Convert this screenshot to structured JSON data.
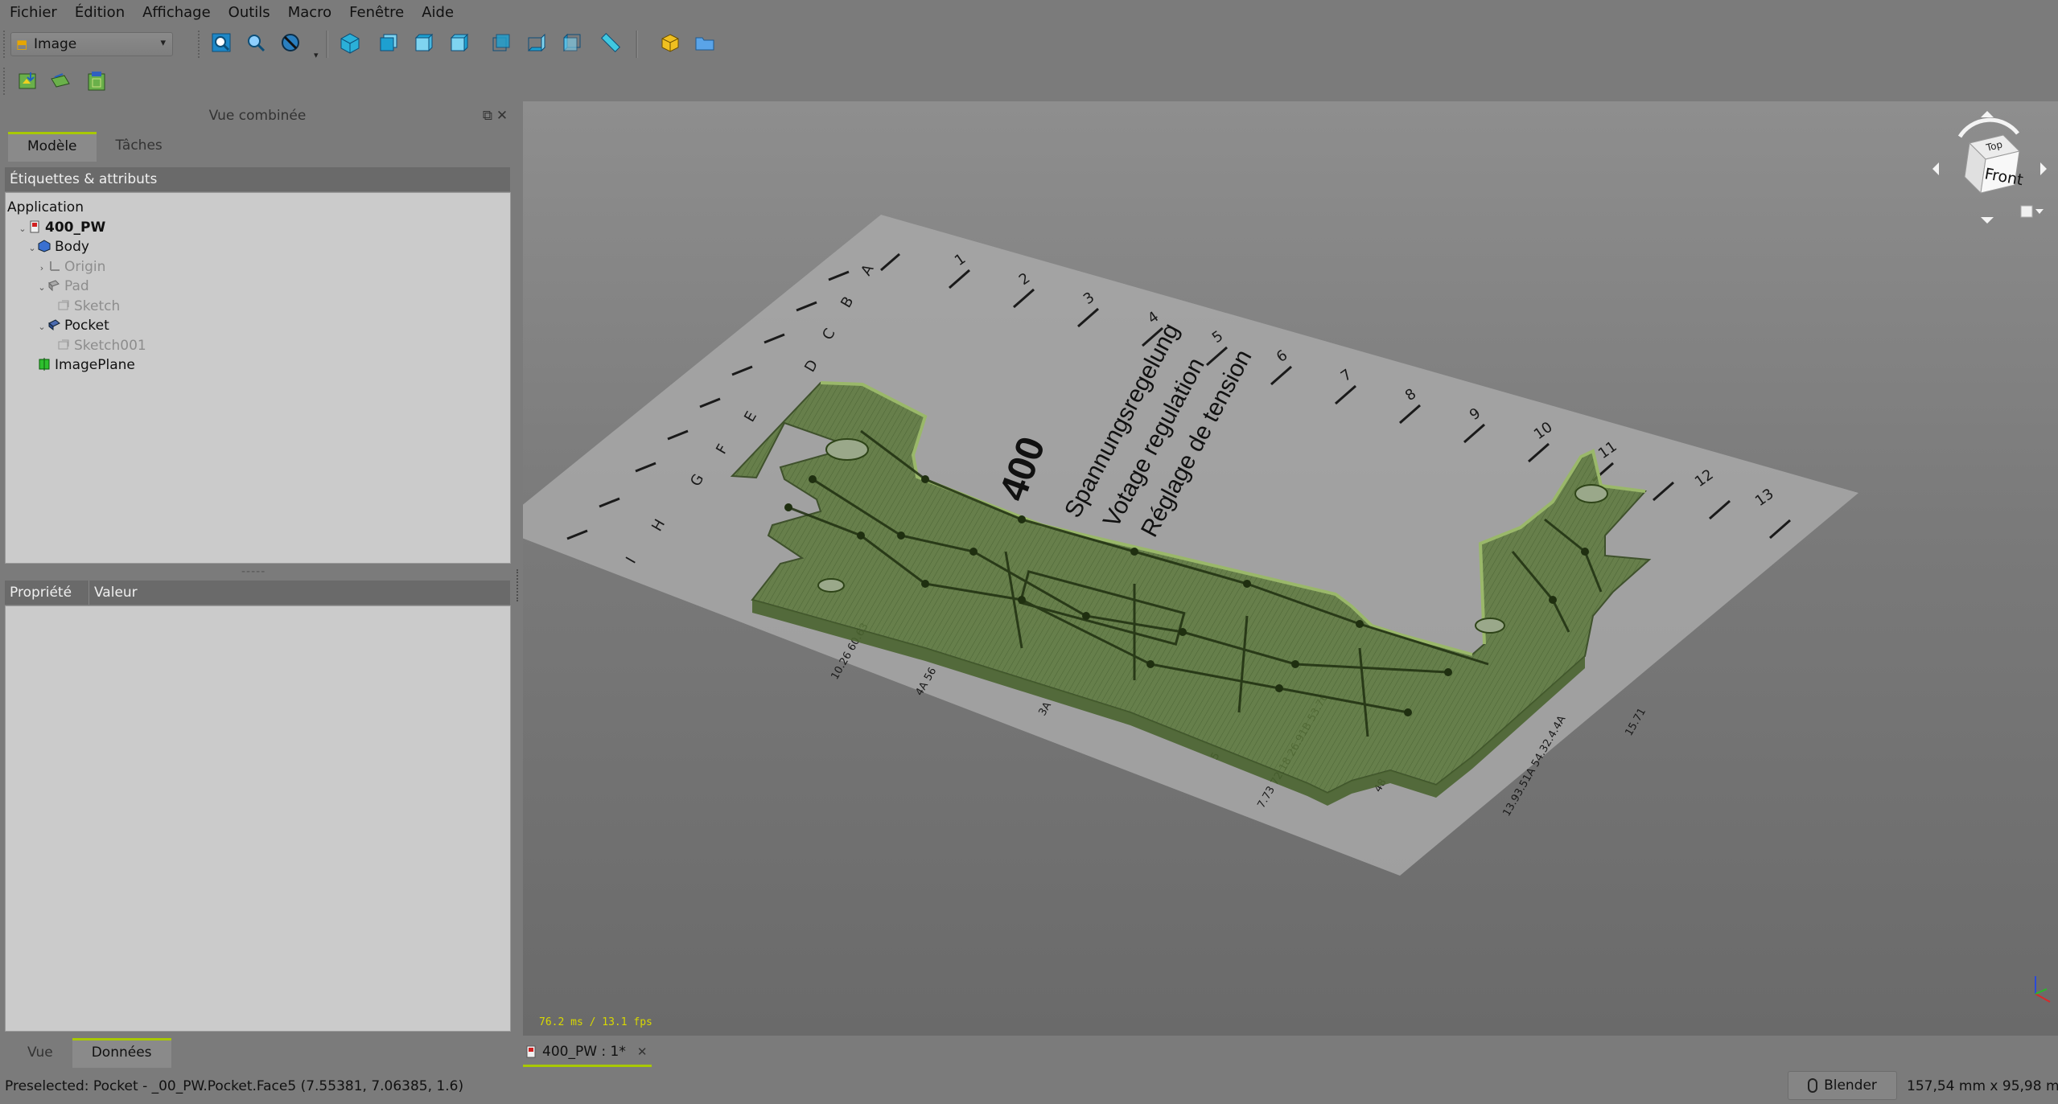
{
  "menu": [
    "Fichier",
    "Édition",
    "Affichage",
    "Outils",
    "Macro",
    "Fenêtre",
    "Aide"
  ],
  "workbench": {
    "selected": "Image",
    "icon": "image-workbench-icon"
  },
  "toolbar_icons": [
    "view-fit-all-icon",
    "view-fit-selection-icon",
    "draw-style-icon",
    "view-isometric-icon",
    "view-front-icon",
    "view-top-icon",
    "view-right-icon",
    "view-rear-icon",
    "view-bottom-icon",
    "view-left-icon",
    "measure-distance-icon",
    "part-icon",
    "folder-icon"
  ],
  "toolbar2_icons": [
    "open-image-icon",
    "create-image-plane-icon",
    "image-scaling-icon"
  ],
  "combo_view": {
    "title": "Vue combinée",
    "tabs": [
      "Modèle",
      "Tâches"
    ],
    "tree_header": "Étiquettes & attributs",
    "tree": [
      {
        "label": "Application",
        "level": 0,
        "icon": "",
        "expander": "",
        "muted": false,
        "bold": false
      },
      {
        "label": "400_PW",
        "level": 1,
        "icon": "document-icon",
        "expander": "v",
        "muted": false,
        "bold": true
      },
      {
        "label": "Body",
        "level": 2,
        "icon": "body-icon",
        "expander": "v",
        "muted": false,
        "bold": false
      },
      {
        "label": "Origin",
        "level": 3,
        "icon": "origin-icon",
        "expander": ">",
        "muted": true,
        "bold": false
      },
      {
        "label": "Pad",
        "level": 3,
        "icon": "pad-icon",
        "expander": "v",
        "muted": true,
        "bold": false
      },
      {
        "label": "Sketch",
        "level": 4,
        "icon": "sketch-icon",
        "expander": "",
        "muted": true,
        "bold": false
      },
      {
        "label": "Pocket",
        "level": 3,
        "icon": "pocket-icon",
        "expander": "v",
        "muted": false,
        "bold": false
      },
      {
        "label": "Sketch001",
        "level": 4,
        "icon": "sketch-icon",
        "expander": "",
        "muted": true,
        "bold": false
      },
      {
        "label": "ImagePlane",
        "level": 2,
        "icon": "image-plane-icon",
        "expander": "",
        "muted": false,
        "bold": false
      }
    ],
    "splitter": "-----",
    "property_headers": [
      "Propriété",
      "Valeur"
    ],
    "bottom_tabs": [
      "Vue",
      "Données"
    ]
  },
  "viewport": {
    "fps": "76.2 ms / 13.1 fps",
    "navcube_face": "Front",
    "navcube_top": "Top",
    "sheet": {
      "number": "400",
      "lines": [
        "Spannungsregelung",
        "Votage regulation",
        "Réglage de tension"
      ],
      "column_labels": [
        "1",
        "2",
        "3",
        "4",
        "5",
        "6",
        "7",
        "8",
        "9",
        "10",
        "11",
        "12",
        "13"
      ],
      "row_labels": [
        "A",
        "B",
        "C",
        "D",
        "E",
        "F",
        "G",
        "H",
        "I"
      ],
      "pin_labels": [
        "10.26 60.63",
        "4A 56",
        "3A",
        "5",
        "7.73 72.18 26.91B 53.76",
        "48",
        "13.93.51A 54.32.4.4A",
        "15.71"
      ]
    }
  },
  "document_tab": {
    "label": "400_PW : 1*"
  },
  "status": {
    "text": "Preselected: Pocket - _00_PW.Pocket.Face5 (7.55381, 7.06385, 1.6)",
    "nav_style": "Blender",
    "dimensions": "157,54 mm x 95,98 mm"
  }
}
